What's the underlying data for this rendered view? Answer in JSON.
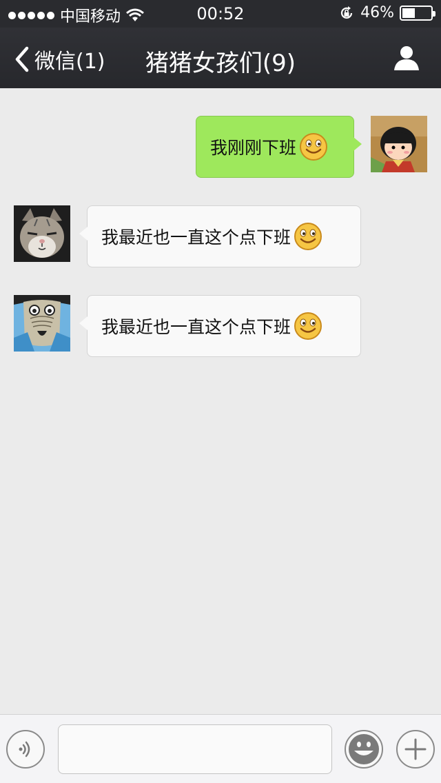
{
  "status_bar": {
    "carrier": "中国移动",
    "time": "00:52",
    "battery_text": "46%",
    "battery_level": 0.46,
    "icons": [
      "signal-dots-icon",
      "wifi-icon",
      "rotation-lock-icon",
      "battery-icon"
    ]
  },
  "nav": {
    "back_label": "微信(1)",
    "title": "猪猪女孩们(9)",
    "icons": [
      "chevron-left-icon",
      "person-icon"
    ]
  },
  "messages": [
    {
      "direction": "outgoing",
      "text": "我刚刚下班",
      "emoji": "smiley-emoji",
      "avatar": "cartoon-girl-avatar"
    },
    {
      "direction": "incoming",
      "text": "我最近也一直这个点下班",
      "emoji": "smiley-emoji",
      "avatar": "cat-avatar"
    },
    {
      "direction": "incoming",
      "text": "我最近也一直这个点下班",
      "emoji": "smiley-emoji",
      "avatar": "cartoon-face-avatar"
    }
  ],
  "input_bar": {
    "message_value": "",
    "icons": [
      "voice-icon",
      "emoji-icon",
      "plus-icon"
    ]
  },
  "colors": {
    "status_bg": "#2a2b2f",
    "nav_bg": "#2c2d31",
    "chat_bg": "#ebebeb",
    "outgoing_bubble": "#9ee85c",
    "incoming_bubble": "#f9f9f9"
  }
}
